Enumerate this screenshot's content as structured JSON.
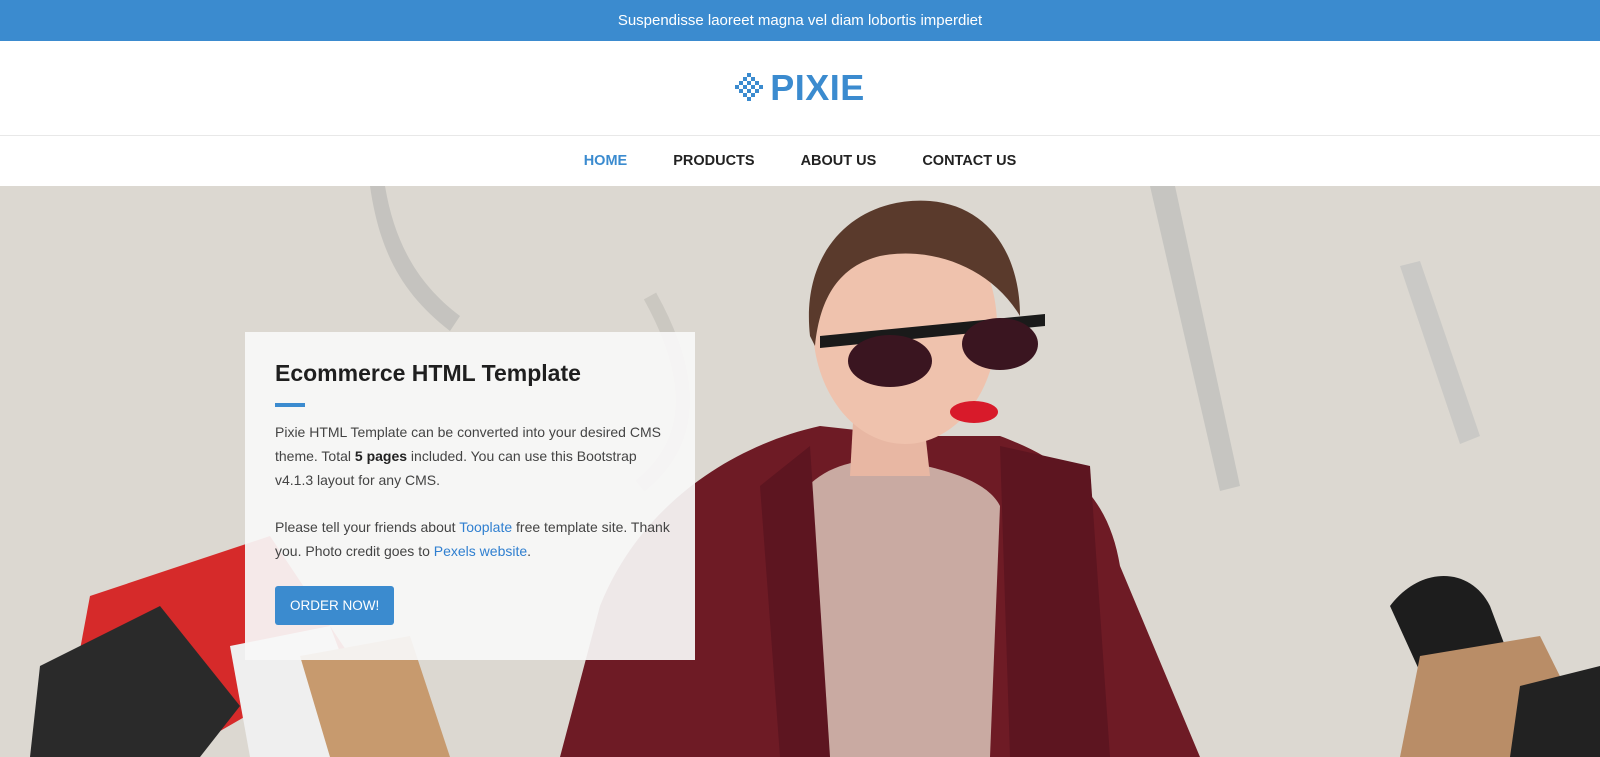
{
  "announcement": {
    "text": "Suspendisse laoreet magna vel diam lobortis imperdiet"
  },
  "brand": {
    "name": "PIXIE",
    "icon": "pixel-diamond-icon",
    "color": "#3b8bcf"
  },
  "nav": {
    "items": [
      {
        "label": "HOME",
        "active": true
      },
      {
        "label": "PRODUCTS",
        "active": false
      },
      {
        "label": "ABOUT US",
        "active": false
      },
      {
        "label": "CONTACT US",
        "active": false
      }
    ]
  },
  "hero": {
    "title": "Ecommerce HTML Template",
    "para1": {
      "pre": "Pixie HTML Template can be converted into your desired CMS theme. Total ",
      "bold": "5 pages",
      "post": " included. You can use this Bootstrap v4.1.3 layout for any CMS."
    },
    "para2": {
      "pre": "Please tell your friends about ",
      "link1": "Tooplate",
      "mid": " free template site. Thank you. Photo credit goes to ",
      "link2": "Pexels website",
      "post": "."
    },
    "button": "ORDER NOW!",
    "image": "woman-with-shopping-bags-photo"
  },
  "colors": {
    "accent": "#3b8bcf",
    "link": "#2f7fd0",
    "text": "#444444"
  }
}
